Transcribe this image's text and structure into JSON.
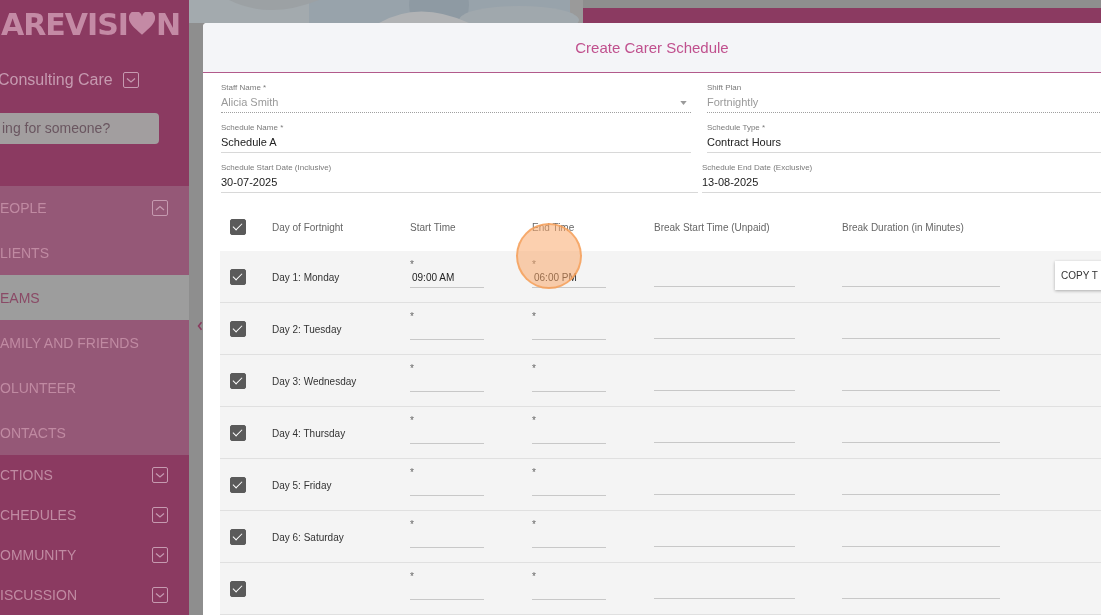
{
  "sidebar": {
    "logo_left": "AREVISI",
    "logo_right": "N",
    "organisation": "Consulting Care",
    "search": {
      "placeholder": "ing for someone?"
    },
    "nav": [
      {
        "label": "EOPLE",
        "expanded": true,
        "children": [
          {
            "label": "LIENTS",
            "selected": false
          },
          {
            "label": "EAMS",
            "selected": true
          },
          {
            "label": "AMILY AND FRIENDS",
            "selected": false
          },
          {
            "label": "OLUNTEER",
            "selected": false
          },
          {
            "label": "ONTACTS",
            "selected": false
          }
        ]
      },
      {
        "label": "CTIONS",
        "expanded": false
      },
      {
        "label": "CHEDULES",
        "expanded": false
      },
      {
        "label": "OMMUNITY",
        "expanded": false
      },
      {
        "label": "ISCUSSION",
        "expanded": false
      }
    ]
  },
  "dialog": {
    "title": "Create Carer Schedule",
    "fields": [
      {
        "label": "Staff Name *",
        "value": "Alicia Smith",
        "kind": "dropdown",
        "disabled": true
      },
      {
        "label": "Shift Plan",
        "value": "Fortnightly",
        "kind": "text",
        "disabled": true
      },
      {
        "label": "Schedule Name *",
        "value": "Schedule A",
        "kind": "text",
        "disabled": false
      },
      {
        "label": "Schedule Type *",
        "value": "Contract Hours",
        "kind": "text",
        "disabled": false
      },
      {
        "label": "Schedule Start Date (Inclusive)",
        "value": "30-07-2025",
        "kind": "text",
        "disabled": false
      },
      {
        "label": "Schedule End Date (Exclusive)",
        "value": "13-08-2025",
        "kind": "text",
        "disabled": false
      }
    ],
    "table": {
      "all_checked": true,
      "columns": [
        "Day of Fortnight",
        "Start Time",
        "End Time",
        "Break Start Time (Unpaid)",
        "Break Duration (in Minutes)"
      ],
      "rows": [
        {
          "checked": true,
          "day": "Day 1: Monday",
          "start": {
            "label": "*",
            "value": "09:00 AM"
          },
          "end": {
            "label": "*",
            "value": "06:00 PM"
          },
          "action": "COPY T"
        },
        {
          "checked": true,
          "day": "Day 2: Tuesday",
          "start": {
            "label": "*"
          },
          "end": {
            "label": "*"
          }
        },
        {
          "checked": true,
          "day": "Day 3: Wednesday",
          "start": {
            "label": "*"
          },
          "end": {
            "label": "*"
          }
        },
        {
          "checked": true,
          "day": "Day 4: Thursday",
          "start": {
            "label": "*"
          },
          "end": {
            "label": "*"
          }
        },
        {
          "checked": true,
          "day": "Day 5: Friday",
          "start": {
            "label": "*"
          },
          "end": {
            "label": "*"
          }
        },
        {
          "checked": true,
          "day": "Day 6: Saturday",
          "start": {
            "label": "*"
          },
          "end": {
            "label": "*"
          }
        },
        {
          "checked": true,
          "start": {
            "label": "*"
          },
          "end": {
            "label": "*"
          }
        }
      ]
    }
  }
}
